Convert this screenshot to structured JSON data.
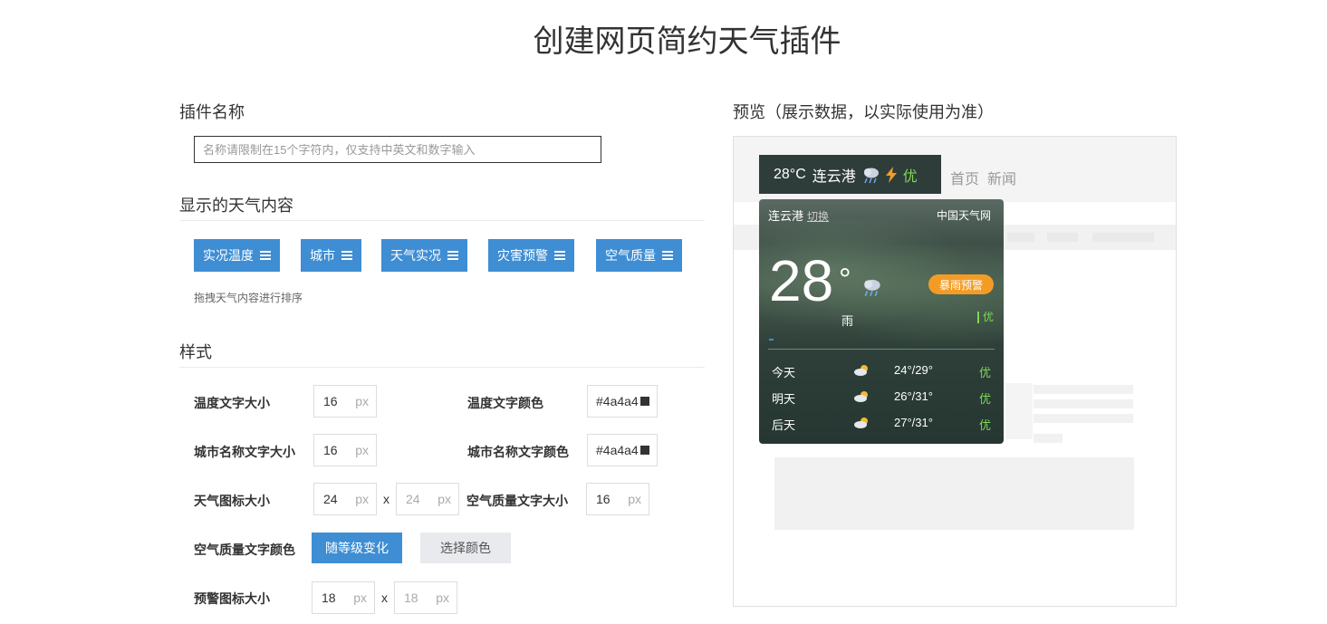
{
  "page": {
    "title": "创建网页简约天气插件"
  },
  "plugin_name": {
    "heading": "插件名称",
    "placeholder": "名称请限制在15个字符内，仅支持中英文和数字输入"
  },
  "content": {
    "heading": "显示的天气内容",
    "chips": [
      "实况温度",
      "城市",
      "天气实况",
      "灾害预警",
      "空气质量"
    ],
    "hint": "拖拽天气内容进行排序"
  },
  "style": {
    "heading": "样式",
    "temp_font_size": {
      "label": "温度文字大小",
      "value": "16",
      "unit": "px"
    },
    "temp_color": {
      "label": "温度文字颜色",
      "value": "#4a4a4"
    },
    "city_font_size": {
      "label": "城市名称文字大小",
      "value": "16",
      "unit": "px"
    },
    "city_color": {
      "label": "城市名称文字颜色",
      "value": "#4a4a4"
    },
    "icon_size": {
      "label": "天气图标大小",
      "w": "24",
      "h": "24",
      "unit": "px",
      "x": "x"
    },
    "aqi_font_size": {
      "label": "空气质量文字大小",
      "value": "16",
      "unit": "px"
    },
    "aqi_color": {
      "label": "空气质量文字颜色",
      "btn_level": "随等级变化",
      "btn_pick": "选择颜色"
    },
    "warn_icon_size": {
      "label": "预警图标大小",
      "w": "18",
      "h": "18",
      "unit": "px",
      "x": "x"
    }
  },
  "preview": {
    "heading": "预览（展示数据，以实际使用为准）",
    "bar": {
      "temp": "28°C",
      "city": "连云港",
      "aqi": "优"
    },
    "nav": [
      "首页",
      "新闻"
    ],
    "card": {
      "city": "连云港",
      "switch": "切换",
      "source": "中国天气网",
      "temp": "28",
      "deg": "°",
      "condition": "雨",
      "warning": "暴雨预警",
      "aqi": "优",
      "forecast": [
        {
          "day": "今天",
          "range": "24°/29°",
          "aqi": "优"
        },
        {
          "day": "明天",
          "range": "26°/31°",
          "aqi": "优"
        },
        {
          "day": "后天",
          "range": "27°/31°",
          "aqi": "优"
        }
      ]
    }
  },
  "colors": {
    "accent": "#3f8ed4",
    "warning": "#f39c25",
    "aqi_good": "#7ed957",
    "bar_bg": "#2f3d3a"
  }
}
